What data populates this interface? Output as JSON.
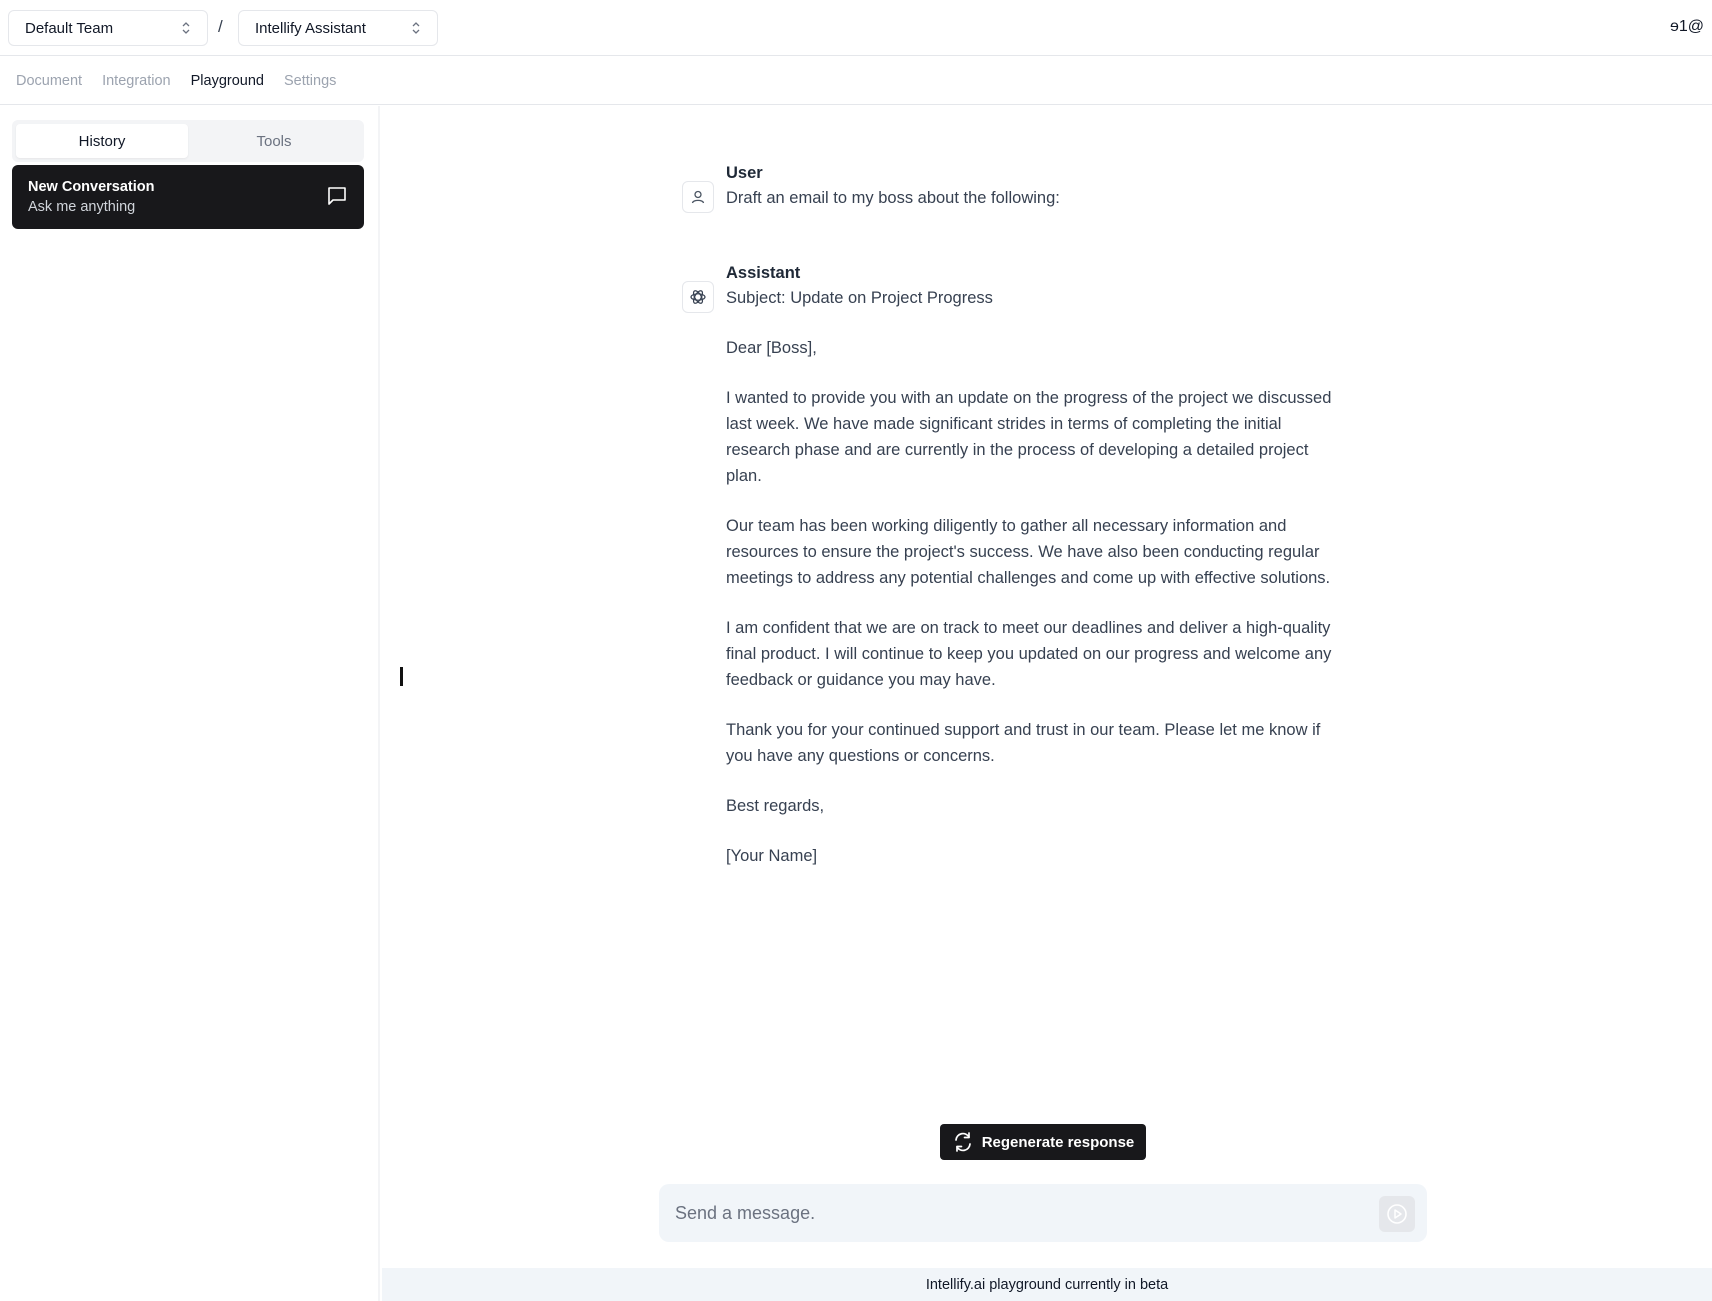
{
  "header": {
    "team_select": "Default Team",
    "separator": "/",
    "assistant_select": "Intellify Assistant",
    "corner_text": "ɘ1@"
  },
  "nav": {
    "tabs": [
      "Document",
      "Integration",
      "Playground",
      "Settings"
    ],
    "active": "Playground"
  },
  "sidebar": {
    "segments": [
      "History",
      "Tools"
    ],
    "active_segment": "History",
    "conversation": {
      "title": "New Conversation",
      "subtitle": "Ask me anything"
    }
  },
  "chat": {
    "user": {
      "role": "User",
      "text": "Draft an email to my boss about the following:"
    },
    "assistant": {
      "role": "Assistant",
      "paragraphs": [
        "Subject: Update on Project Progress",
        "Dear [Boss],",
        "I wanted to provide you with an update on the progress of the project we discussed last week. We have made significant strides in terms of completing the initial research phase and are currently in the process of developing a detailed project plan.",
        "Our team has been working diligently to gather all necessary information and resources to ensure the project's success. We have also been conducting regular meetings to address any potential challenges and come up with effective solutions.",
        "I am confident that we are on track to meet our deadlines and deliver a high-quality final product. I will continue to keep you updated on our progress and welcome any feedback or guidance you may have.",
        "Thank you for your continued support and trust in our team. Please let me know if you have any questions or concerns.",
        "Best regards,",
        "[Your Name]"
      ]
    },
    "regenerate_label": "Regenerate response",
    "input_placeholder": "Send a message.",
    "input_value": ""
  },
  "footer": {
    "text": "Intellify.ai playground currently in beta"
  }
}
